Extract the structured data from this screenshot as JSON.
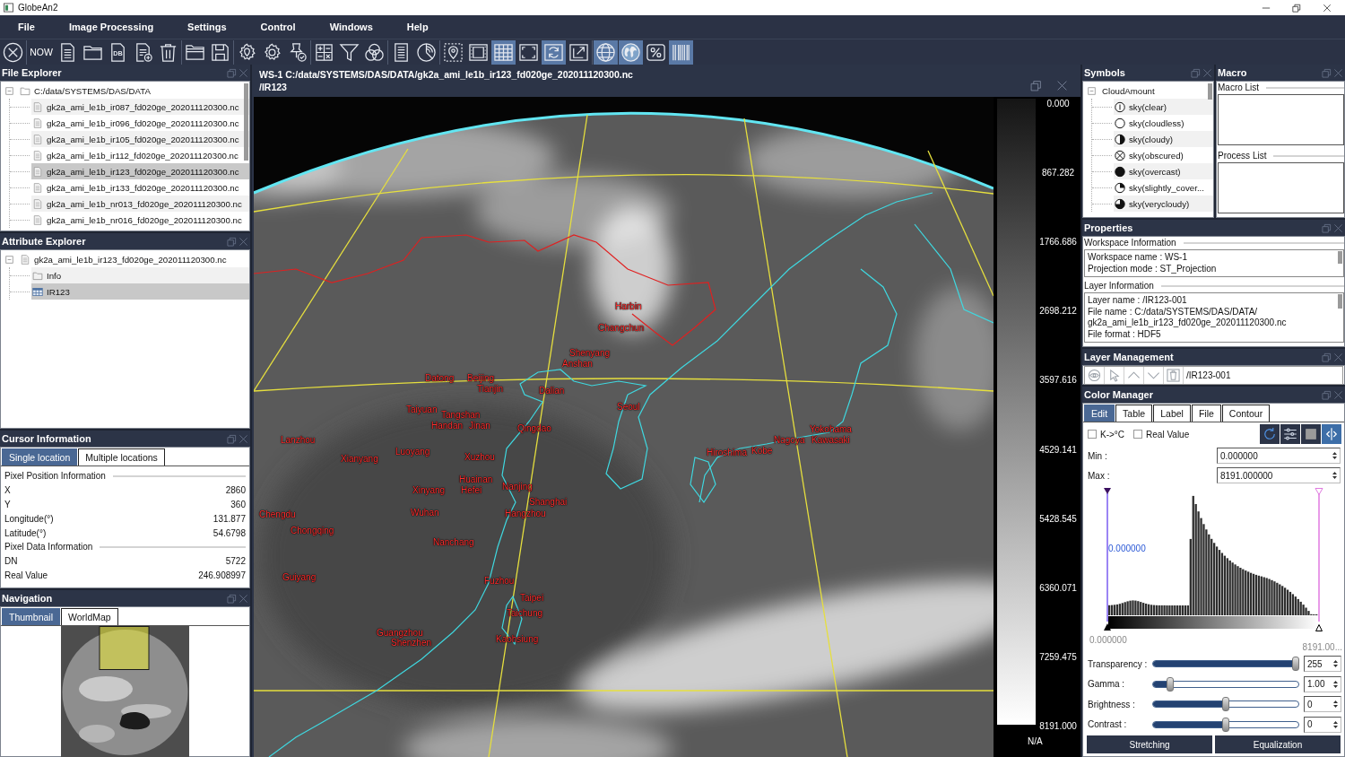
{
  "window": {
    "title": "GlobeAn2"
  },
  "menu": [
    "File",
    "Image Processing",
    "Settings",
    "Control",
    "Windows",
    "Help"
  ],
  "toolbar": [
    {
      "selected": false
    },
    {
      "label": "NOW",
      "selected": false
    },
    {
      "selected": false
    },
    {
      "selected": false
    },
    {
      "label": "DB",
      "selected": false
    },
    {
      "selected": false
    },
    {
      "selected": false
    },
    {
      "selected": false
    },
    {
      "selected": false
    },
    {
      "selected": false
    },
    {
      "selected": false
    },
    {
      "selected": false
    },
    {
      "selected": false
    },
    {
      "selected": false
    },
    {
      "selected": false
    },
    {
      "selected": false
    },
    {
      "selected": false
    },
    {
      "selected": false
    },
    {
      "selected": false
    },
    {
      "selected": true
    },
    {
      "selected": false
    },
    {
      "selected": true
    },
    {
      "selected": false
    },
    {
      "selected": true
    },
    {
      "selected": true
    },
    {
      "selected": false
    },
    {
      "selected": true
    }
  ],
  "file_explorer": {
    "title": "File Explorer",
    "tree": [
      {
        "label": "C:/data/SYSTEMS/DAS/DATA",
        "kind": "folder",
        "expanded": true,
        "selected": false,
        "children": [
          {
            "label": "gk2a_ami_le1b_ir087_fd020ge_202011120300.nc",
            "kind": "file",
            "selected": false
          },
          {
            "label": "gk2a_ami_le1b_ir096_fd020ge_202011120300.nc",
            "kind": "file",
            "selected": false
          },
          {
            "label": "gk2a_ami_le1b_ir105_fd020ge_202011120300.nc",
            "kind": "file",
            "selected": false
          },
          {
            "label": "gk2a_ami_le1b_ir112_fd020ge_202011120300.nc",
            "kind": "file",
            "selected": false
          },
          {
            "label": "gk2a_ami_le1b_ir123_fd020ge_202011120300.nc",
            "kind": "file",
            "selected": true
          },
          {
            "label": "gk2a_ami_le1b_ir133_fd020ge_202011120300.nc",
            "kind": "file",
            "selected": false
          },
          {
            "label": "gk2a_ami_le1b_nr013_fd020ge_202011120300.nc",
            "kind": "file",
            "selected": false
          },
          {
            "label": "gk2a_ami_le1b_nr016_fd020ge_202011120300.nc",
            "kind": "file",
            "selected": false
          }
        ]
      }
    ]
  },
  "attribute_explorer": {
    "title": "Attribute Explorer",
    "tree": [
      {
        "label": "gk2a_ami_le1b_ir123_fd020ge_202011120300.nc",
        "kind": "file",
        "expanded": true,
        "selected": false,
        "children": [
          {
            "label": "Info",
            "kind": "folder",
            "selected": false
          },
          {
            "label": "IR123",
            "kind": "table",
            "selected": true
          }
        ]
      }
    ]
  },
  "cursor_information": {
    "title": "Cursor Information",
    "tabs": [
      {
        "label": "Single location",
        "selected": true
      },
      {
        "label": "Multiple locations",
        "selected": false
      }
    ],
    "groups": [
      {
        "title": "Pixel Position Information",
        "rows": [
          {
            "label": "X",
            "value": "2860"
          },
          {
            "label": "Y",
            "value": "360"
          },
          {
            "label": "Longitude(°)",
            "value": "131.877"
          },
          {
            "label": "Latitude(°)",
            "value": "54.6798"
          }
        ]
      },
      {
        "title": "Pixel Data Information",
        "rows": [
          {
            "label": "DN",
            "value": "5722"
          },
          {
            "label": "Real Value",
            "value": "246.908997"
          }
        ]
      }
    ]
  },
  "navigation": {
    "title": "Navigation",
    "tabs": [
      {
        "label": "Thumbnail",
        "selected": true
      },
      {
        "label": "WorldMap",
        "selected": false
      }
    ]
  },
  "workspace": {
    "title": "WS-1 C:/data/SYSTEMS/DAS/DATA/gk2a_ami_le1b_ir123_fd020ge_202011120300.nc",
    "subtitle": "/IR123",
    "map_labels": [
      "Harbin",
      "Changchun",
      "Shenyang",
      "Anshan",
      "Datong",
      "Beijing",
      "Tianjin",
      "Dalian",
      "Taiyuan",
      "Tangshan",
      "Seoul",
      "Handan",
      "Jinan",
      "Qingdao",
      "Yokohama",
      "Lanzhou",
      "Nagoya",
      "Kawasaki",
      "Xianyang",
      "Luoyang",
      "Xuzhou",
      "Hiroshima",
      "Kobe",
      "Huainan",
      "Xinyang",
      "Hefei",
      "Nanjing",
      "Shanghai",
      "Chengdu",
      "Wuhan",
      "Hangzhou",
      "Chongqing",
      "Nanchang",
      "Guiyang",
      "Fuzhou",
      "Taipei",
      "Taichung",
      "Guangzhou",
      "Shenzhen",
      "Kaohsiung"
    ],
    "color_scale": {
      "ticks": [
        "0.000",
        "867.282",
        "1766.686",
        "2698.212",
        "3597.616",
        "4529.141",
        "5428.545",
        "6360.071",
        "7259.475",
        "8191.000"
      ],
      "no_data": "N/A"
    }
  },
  "symbols": {
    "title": "Symbols",
    "tree": [
      {
        "label": "CloudAmount",
        "expanded": true,
        "selected": false,
        "children": [
          {
            "label": "sky(clear)",
            "kind": "clear",
            "selected": false
          },
          {
            "label": "sky(cloudless)",
            "kind": "empty",
            "selected": false
          },
          {
            "label": "sky(cloudy)",
            "kind": "half",
            "selected": false
          },
          {
            "label": "sky(obscured)",
            "kind": "cross",
            "selected": false
          },
          {
            "label": "sky(overcast)",
            "kind": "full",
            "selected": false
          },
          {
            "label": "sky(slightly_cover...",
            "kind": "quarter",
            "selected": false
          },
          {
            "label": "sky(verycloudy)",
            "kind": "threequarter",
            "selected": false
          }
        ]
      }
    ]
  },
  "macro": {
    "title": "Macro",
    "lists": [
      "Macro List",
      "Process List"
    ]
  },
  "properties": {
    "title": "Properties",
    "sections": [
      {
        "title": "Workspace Information",
        "lines": [
          "Workspace name : WS-1",
          "Projection mode : ST_Projection"
        ]
      },
      {
        "title": "Layer Information",
        "lines": [
          "Layer name : /IR123-001",
          "File name : C:/data/SYSTEMS/DAS/DATA/",
          "gk2a_ami_le1b_ir123_fd020ge_202011120300.nc",
          "File format : HDF5"
        ]
      }
    ]
  },
  "layer_management": {
    "title": "Layer Management",
    "layer": "/IR123-001"
  },
  "color_manager": {
    "title": "Color Manager",
    "tabs": [
      {
        "label": "Edit",
        "selected": true
      },
      {
        "label": "Table",
        "selected": false
      },
      {
        "label": "Label",
        "selected": false
      },
      {
        "label": "File",
        "selected": false
      },
      {
        "label": "Contour",
        "selected": false
      }
    ],
    "options": [
      {
        "label": "K->°C",
        "checked": false
      },
      {
        "label": "Real Value",
        "checked": false
      }
    ],
    "range": [
      {
        "label": "Min :",
        "value": "0.000000"
      },
      {
        "label": "Max :",
        "value": "8191.000000"
      }
    ],
    "histogram": {
      "marker_value": "0.000000",
      "min_label": "0.000000",
      "max_label": "8191.00..."
    },
    "sliders": [
      {
        "label": "Transparency :",
        "level": 1.0,
        "value": "255"
      },
      {
        "label": "Gamma :",
        "level": 0.1,
        "value": "1.00"
      },
      {
        "label": "Brightness :",
        "level": 0.5,
        "value": "0"
      },
      {
        "label": "Contrast :",
        "level": 0.5,
        "value": "0"
      }
    ],
    "buttons": [
      "Stretching",
      "Equalization"
    ]
  }
}
